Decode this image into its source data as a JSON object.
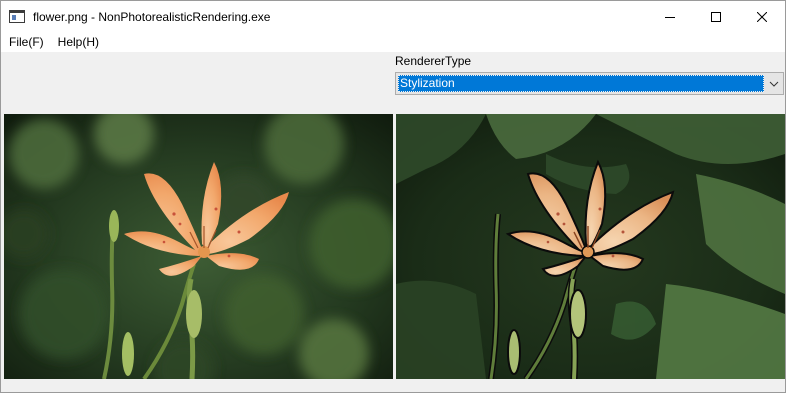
{
  "window": {
    "title": "flower.png - NonPhotorealisticRendering.exe"
  },
  "menu": {
    "items": [
      {
        "label": "File(F)"
      },
      {
        "label": "Help(H)"
      }
    ]
  },
  "renderer": {
    "label": "RendererType",
    "selected": "Stylization"
  },
  "images": {
    "original": "photo-image",
    "rendered": "stylized-image"
  },
  "icons": {
    "app": "window-app-icon",
    "minimize": "minimize-icon",
    "maximize": "maximize-icon",
    "close": "close-icon",
    "dropdown": "chevron-down-icon"
  },
  "colors": {
    "selection": "#0078d7",
    "window_bg": "#f0f0f0",
    "titlebar_bg": "#ffffff"
  }
}
